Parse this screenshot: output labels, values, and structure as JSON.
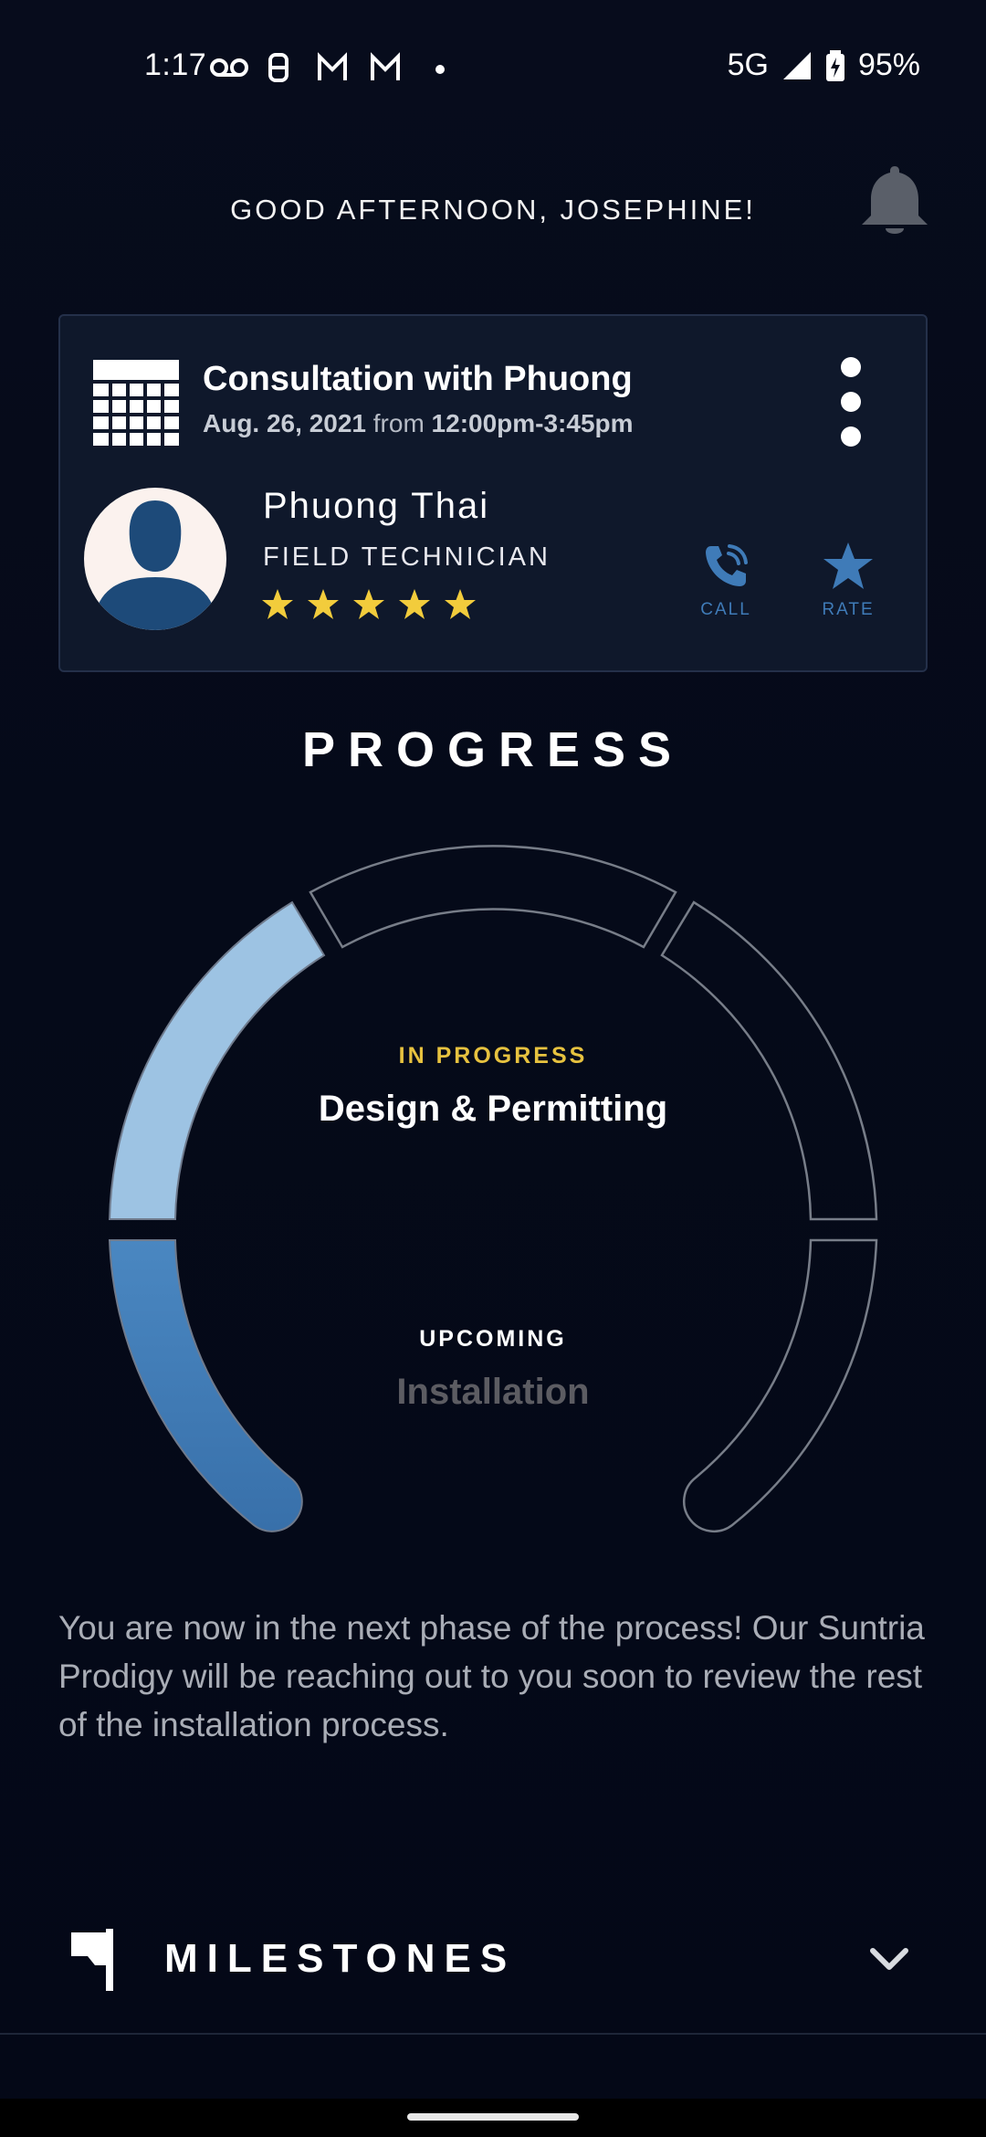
{
  "status_bar": {
    "time": "1:17",
    "network": "5G",
    "battery": "95%"
  },
  "greeting": "GOOD AFTERNOON, JOSEPHINE!",
  "appointment": {
    "title": "Consultation with Phuong",
    "date": "Aug. 26, 2021",
    "from_word": "from",
    "time_range": "12:00pm-3:45pm",
    "technician_name": "Phuong Thai",
    "technician_role": "FIELD TECHNICIAN",
    "rating": 5,
    "call_label": "CALL",
    "rate_label": "RATE"
  },
  "progress": {
    "title": "PROGRESS",
    "current_tag": "IN PROGRESS",
    "current_phase": "Design & Permitting",
    "upcoming_tag": "UPCOMING",
    "upcoming_phase": "Installation"
  },
  "description": "You are now in the next phase of the process! Our Suntria Prodigy will be reaching out to you soon to review the rest of the installation process.",
  "milestones_label": "MILESTONES",
  "colors": {
    "background": "#050a19",
    "card": "#0f182b",
    "accent_blue": "#3f7bb8",
    "star_yellow": "#f2cc3c",
    "in_progress_yellow": "#e7c23f",
    "ring_done_dark": "#3d76b0",
    "ring_done_light": "#9dc3e3"
  }
}
